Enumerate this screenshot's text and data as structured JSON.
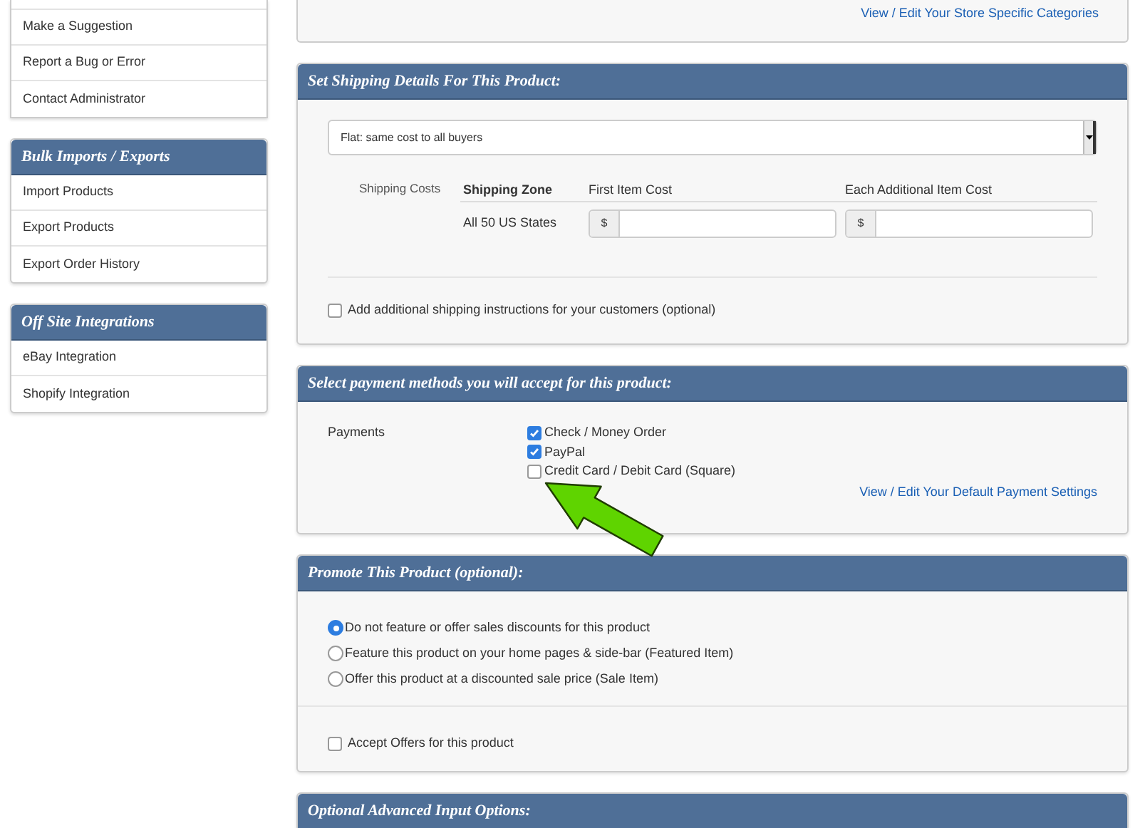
{
  "sidebar": {
    "top_menu": [
      "Make a Suggestion",
      "Report a Bug or Error",
      "Contact Administrator"
    ],
    "sections": [
      {
        "title": "Bulk Imports / Exports",
        "items": [
          "Import Products",
          "Export Products",
          "Export Order History"
        ]
      },
      {
        "title": "Off Site Integrations",
        "items": [
          "eBay Integration",
          "Shopify Integration"
        ]
      }
    ]
  },
  "categories_link": "View / Edit Your Store Specific Categories",
  "shipping": {
    "title": "Set Shipping Details For This Product:",
    "method": "Flat: same cost to all buyers",
    "costs_label": "Shipping Costs",
    "columns": [
      "Shipping Zone",
      "First Item Cost",
      "Each Additional Item Cost"
    ],
    "rows": [
      {
        "zone": "All 50 US States",
        "first_currency": "$",
        "additional_currency": "$"
      }
    ],
    "instructions": {
      "label": "Add additional shipping instructions for your customers (optional)",
      "checked": false
    }
  },
  "payments": {
    "title": "Select payment methods you will accept for this product:",
    "label": "Payments",
    "methods": [
      {
        "label": "Check / Money Order",
        "checked": true
      },
      {
        "label": "PayPal",
        "checked": true
      },
      {
        "label": "Credit Card / Debit Card (Square)",
        "checked": false
      }
    ],
    "settings_link": "View / Edit Your Default Payment Settings"
  },
  "promote": {
    "title": "Promote This Product (optional):",
    "options": [
      {
        "label": "Do not feature or offer sales discounts for this product",
        "selected": true
      },
      {
        "label": "Feature this product on your home pages & side-bar (Featured Item)",
        "selected": false
      },
      {
        "label": "Offer this product at a discounted sale price (Sale Item)",
        "selected": false
      }
    ],
    "accept_offers": {
      "label": "Accept Offers for this product",
      "checked": false
    }
  },
  "advanced": {
    "title": "Optional Advanced Input Options:"
  }
}
